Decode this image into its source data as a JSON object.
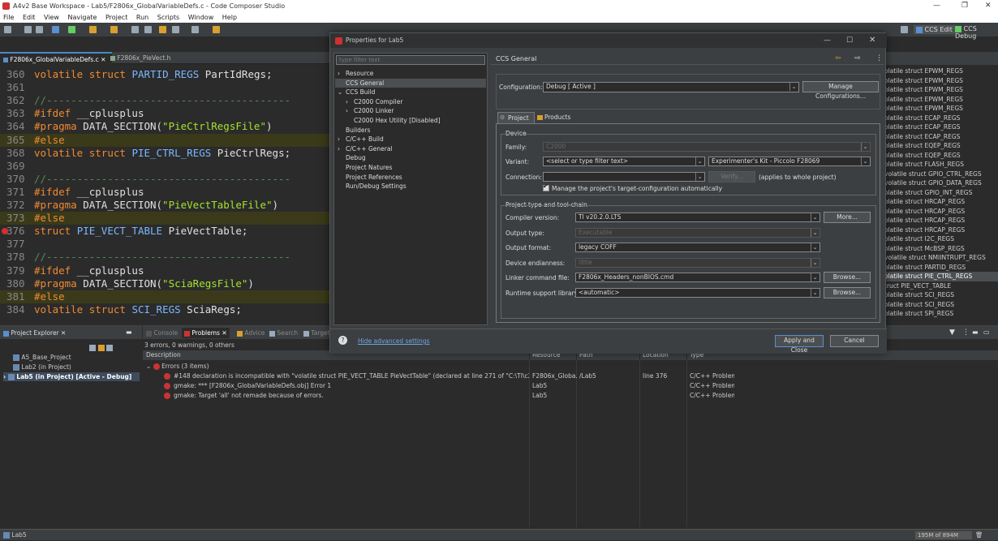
{
  "window": {
    "title": "A4v2 Base Workspace - Lab5/F2806x_GlobalVariableDefs.c - Code Composer Studio",
    "controls": [
      "—",
      "❐",
      "✕"
    ]
  },
  "menu": [
    "File",
    "Edit",
    "View",
    "Navigate",
    "Project",
    "Run",
    "Scripts",
    "Window",
    "Help"
  ],
  "perspectives": {
    "edit": "CCS Edit",
    "debug": "CCS Debug"
  },
  "editor_tabs": [
    {
      "label": "F2806x_GlobalVariableDefs.c",
      "active": true
    },
    {
      "label": "F2806x_PieVect.h",
      "active": false
    }
  ],
  "code_lines": [
    {
      "num": "360",
      "text": "volatile struct PARTID_REGS PartIdRegs;"
    },
    {
      "num": "361",
      "text": ""
    },
    {
      "num": "362",
      "text": "//----------------------------------------"
    },
    {
      "num": "363",
      "text": "#ifdef __cplusplus"
    },
    {
      "num": "364",
      "text": "#pragma DATA_SECTION(\"PieCtrlRegsFile\")"
    },
    {
      "num": "365",
      "text": "#else"
    },
    {
      "num": "368",
      "text": "volatile struct PIE_CTRL_REGS PieCtrlRegs;"
    },
    {
      "num": "369",
      "text": ""
    },
    {
      "num": "370",
      "text": "//----------------------------------------"
    },
    {
      "num": "371",
      "text": "#ifdef __cplusplus"
    },
    {
      "num": "372",
      "text": "#pragma DATA_SECTION(\"PieVectTableFile\")"
    },
    {
      "num": "373",
      "text": "#else"
    },
    {
      "num": "376",
      "text": "struct PIE_VECT_TABLE PieVectTable;"
    },
    {
      "num": "377",
      "text": ""
    },
    {
      "num": "378",
      "text": "//----------------------------------------"
    },
    {
      "num": "379",
      "text": "#ifdef __cplusplus"
    },
    {
      "num": "380",
      "text": "#pragma DATA_SECTION(\"SciaRegsFile\")"
    },
    {
      "num": "381",
      "text": "#else"
    },
    {
      "num": "384",
      "text": "volatile struct SCI_REGS SciaRegs;"
    }
  ],
  "outline_items": [
    "olatile struct EPWM_REGS",
    "olatile struct EPWM_REGS",
    "olatile struct EPWM_REGS",
    "olatile struct EPWM_REGS",
    "olatile struct EPWM_REGS",
    "olatile struct ECAP_REGS",
    "olatile struct ECAP_REGS",
    "olatile struct ECAP_REGS",
    "olatile struct EQEP_REGS",
    "olatile struct EQEP_REGS",
    "olatile struct FLASH_REGS",
    "volatile struct GPIO_CTRL_REGS",
    "volatile struct GPIO_DATA_REGS",
    "olatile struct GPIO_INT_REGS",
    "olatile struct HRCAP_REGS",
    "olatile struct HRCAP_REGS",
    "olatile struct HRCAP_REGS",
    "olatile struct HRCAP_REGS",
    "olatile struct I2C_REGS",
    "olatile struct McBSP_REGS",
    "volatile struct NMIINTRUPT_REGS",
    "olatile struct PARTID_REGS",
    "olatile struct PIE_CTRL_REGS",
    "truct PIE_VECT_TABLE",
    "olatile struct SCI_REGS",
    "olatile struct SCI_REGS",
    "olatile struct SPI_REGS"
  ],
  "explorer": {
    "title": "Project Explorer",
    "items": [
      "A5_Base_Project",
      "Lab2 (in Project)",
      "Lab5 (in Project)  [Active - Debug]"
    ]
  },
  "problems": {
    "tabs": [
      "Console",
      "Problems",
      "Advice",
      "Search",
      "Target"
    ],
    "summary": "3 errors, 0 warnings, 0 others",
    "columns": [
      "Description",
      "Resource",
      "Path",
      "Location",
      "Type"
    ],
    "group": "Errors (3 items)",
    "rows": [
      {
        "desc": "#148 declaration is incompatible with \"volatile struct PIE_VECT_TABLE PieVectTable\" (declared at line 271 of \"C:\\TI\\c2000\\C2000Wa",
        "resource": "F2806x_Globa...",
        "path": "/Lab5",
        "location": "line 376",
        "type": "C/C++ Problem"
      },
      {
        "desc": "gmake: *** [F2806x_GlobalVariableDefs.obj] Error 1",
        "resource": "Lab5",
        "path": "",
        "location": "",
        "type": "C/C++ Problem"
      },
      {
        "desc": "gmake: Target 'all' not remade because of errors.",
        "resource": "Lab5",
        "path": "",
        "location": "",
        "type": "C/C++ Problem"
      }
    ]
  },
  "status": {
    "left": "Lab5",
    "memory": "195M of 894M"
  },
  "dialog": {
    "title": "Properties for Lab5",
    "filter_placeholder": "type filter text",
    "nav": [
      {
        "label": "Resource",
        "indent": 0,
        "arrow": "›"
      },
      {
        "label": "CCS General",
        "indent": 0,
        "arrow": "",
        "sel": true
      },
      {
        "label": "CCS Build",
        "indent": 0,
        "arrow": "⌄"
      },
      {
        "label": "C2000 Compiler",
        "indent": 2,
        "arrow": "›"
      },
      {
        "label": "C2000 Linker",
        "indent": 2,
        "arrow": "›"
      },
      {
        "label": "C2000 Hex Utility  [Disabled]",
        "indent": 2,
        "arrow": ""
      },
      {
        "label": "Builders",
        "indent": 0,
        "arrow": ""
      },
      {
        "label": "C/C++ Build",
        "indent": 0,
        "arrow": "›"
      },
      {
        "label": "C/C++ General",
        "indent": 0,
        "arrow": "›"
      },
      {
        "label": "Debug",
        "indent": 0,
        "arrow": ""
      },
      {
        "label": "Project Natures",
        "indent": 0,
        "arrow": ""
      },
      {
        "label": "Project References",
        "indent": 0,
        "arrow": ""
      },
      {
        "label": "Run/Debug Settings",
        "indent": 0,
        "arrow": ""
      }
    ],
    "page_title": "CCS General",
    "configuration_label": "Configuration:",
    "configuration_value": "Debug  [ Active ]",
    "manage_button": "Manage Configurations...",
    "tabs": [
      "Project",
      "Products"
    ],
    "device_group": "Device",
    "family_label": "Family:",
    "family_value": "C2000",
    "variant_label": "Variant:",
    "variant_filter": "<select or type filter text>",
    "variant_value": "Experimenter's Kit - Piccolo F28069",
    "connection_label": "Connection:",
    "connection_value": "",
    "verify_button": "Verify...",
    "connection_note": "(applies to whole project)",
    "manage_target_check": "Manage the project's target-configuration automatically",
    "toolchain_group": "Project type and tool-chain",
    "compiler_label": "Compiler version:",
    "compiler_value": "TI v20.2.0.LTS",
    "more_button": "More...",
    "output_type_label": "Output type:",
    "output_type_value": "Executable",
    "output_format_label": "Output format:",
    "output_format_value": "legacy COFF",
    "endianness_label": "Device endianness:",
    "endianness_value": "little",
    "linker_label": "Linker command file:",
    "linker_value": "F2806x_Headers_nonBIOS.cmd",
    "browse_button": "Browse...",
    "runtime_label": "Runtime support library:",
    "runtime_value": "<automatic>",
    "advanced_link": "Hide advanced settings",
    "apply_close": "Apply and Close",
    "cancel": "Cancel"
  }
}
